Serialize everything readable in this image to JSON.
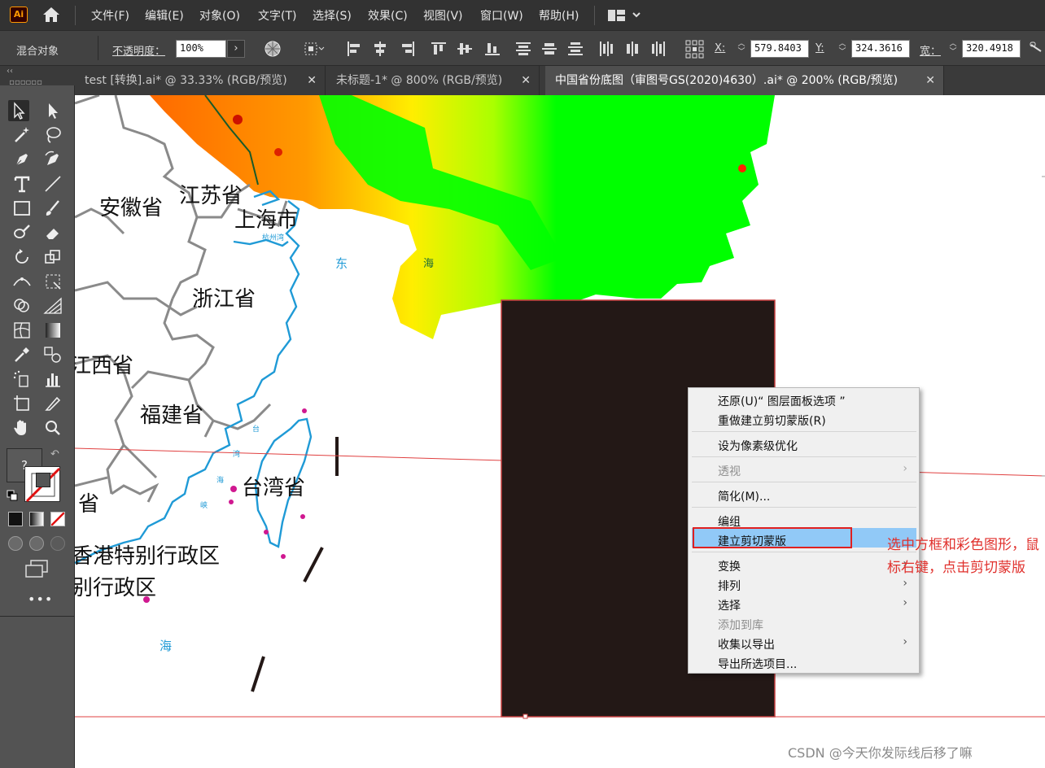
{
  "app": {
    "logo": "Ai"
  },
  "menubar": {
    "items": [
      "文件(F)",
      "编辑(E)",
      "对象(O)",
      "文字(T)",
      "选择(S)",
      "效果(C)",
      "视图(V)",
      "窗口(W)",
      "帮助(H)"
    ]
  },
  "controlbar": {
    "object_type": "混合对象",
    "opacity_label": "不透明度：",
    "opacity_value": "100%",
    "x_label": "X:",
    "x_value": "579.8403",
    "y_label": "Y:",
    "y_value": "324.3616",
    "w_label": "宽：",
    "w_value": "320.4918"
  },
  "tabs": [
    {
      "label": "test [转换].ai* @ 33.33% (RGB/预览)",
      "active": false
    },
    {
      "label": "未标题-1* @ 800% (RGB/预览)",
      "active": false
    },
    {
      "label": "中国省份底图（审图号GS(2020)4630）.ai* @ 200% (RGB/预览)",
      "active": true
    }
  ],
  "map": {
    "provinces": [
      "安徽省",
      "江苏省",
      "上海市",
      "浙江省",
      "江西省",
      "福建省",
      "台湾省",
      "省",
      "香港特别行政区",
      "别行政区"
    ],
    "sea_labels": [
      "东",
      "海",
      "海"
    ],
    "small_labels": [
      "杭州湾",
      "台",
      "湾",
      "海",
      "峡"
    ]
  },
  "toolbar": {
    "fill_stroke_label": "?"
  },
  "context_menu": {
    "items": [
      {
        "label": "还原(U)“ 图层面板选项 ”",
        "disabled": false,
        "submenu": false
      },
      {
        "label": "重做建立剪切蒙版(R)",
        "disabled": false,
        "submenu": false
      },
      {
        "label": "设为像素级优化",
        "disabled": false,
        "submenu": false
      },
      {
        "label": "透视",
        "disabled": true,
        "submenu": true
      },
      {
        "label": "简化(M)...",
        "disabled": false,
        "submenu": false
      },
      {
        "label": "编组",
        "disabled": false,
        "submenu": false
      },
      {
        "label": "建立剪切蒙版",
        "disabled": false,
        "submenu": false,
        "highlighted": true
      },
      {
        "label": "变换",
        "disabled": false,
        "submenu": true
      },
      {
        "label": "排列",
        "disabled": false,
        "submenu": true
      },
      {
        "label": "选择",
        "disabled": false,
        "submenu": true
      },
      {
        "label": "添加到库",
        "disabled": true,
        "submenu": false
      },
      {
        "label": "收集以导出",
        "disabled": false,
        "submenu": true
      },
      {
        "label": "导出所选项目...",
        "disabled": false,
        "submenu": false
      }
    ]
  },
  "annotation": {
    "text": "选中方框和彩色图形，鼠标右键，点击剪切蒙版"
  },
  "watermark": "CSDN @今天你发际线后移了嘛",
  "colors": {
    "accent": "#91c9f7",
    "annotation": "#e0302c",
    "rect_fill": "#231816",
    "terrain_low": "#00ff00",
    "terrain_high": "#ff6600"
  }
}
